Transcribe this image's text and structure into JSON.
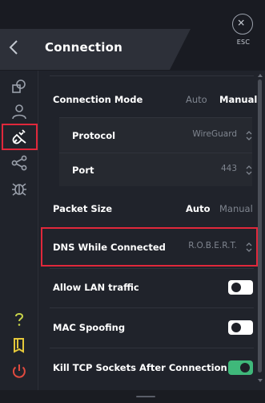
{
  "header": {
    "title": "Connection",
    "esc_label": "ESC"
  },
  "sidebar": {
    "items": [
      {
        "icon": "shapes-icon"
      },
      {
        "icon": "user-icon"
      },
      {
        "icon": "connection-plug-icon",
        "active": true
      },
      {
        "icon": "share-icon"
      },
      {
        "icon": "bug-icon"
      },
      {
        "icon": "help-icon"
      },
      {
        "icon": "book-icon"
      },
      {
        "icon": "power-icon"
      }
    ]
  },
  "settings": {
    "connection_mode": {
      "label": "Connection Mode",
      "options": [
        "Auto",
        "Manual"
      ],
      "selected": "Manual"
    },
    "protocol": {
      "label": "Protocol",
      "value": "WireGuard"
    },
    "port": {
      "label": "Port",
      "value": "443"
    },
    "packet_size": {
      "label": "Packet Size",
      "options": [
        "Auto",
        "Manual"
      ],
      "selected": "Auto"
    },
    "dns": {
      "label": "DNS While Connected",
      "value": "R.O.B.E.R.T."
    },
    "allow_lan": {
      "label": "Allow LAN traffic",
      "enabled": false
    },
    "mac_spoofing": {
      "label": "MAC Spoofing",
      "enabled": false
    },
    "kill_tcp": {
      "label": "Kill TCP Sockets After Connection",
      "enabled": true
    }
  },
  "colors": {
    "accent_green": "#3fb87a",
    "highlight_red": "#e0283b",
    "help_yellow": "#c8d44a",
    "power_red": "#e04a3f"
  }
}
